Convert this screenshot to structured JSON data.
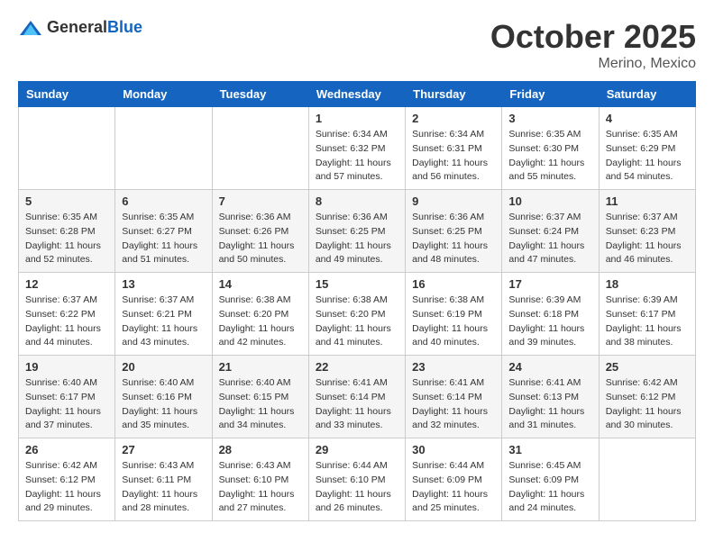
{
  "header": {
    "logo_general": "General",
    "logo_blue": "Blue",
    "month": "October 2025",
    "location": "Merino, Mexico"
  },
  "days_of_week": [
    "Sunday",
    "Monday",
    "Tuesday",
    "Wednesday",
    "Thursday",
    "Friday",
    "Saturday"
  ],
  "weeks": [
    [
      {
        "day": "",
        "info": ""
      },
      {
        "day": "",
        "info": ""
      },
      {
        "day": "",
        "info": ""
      },
      {
        "day": "1",
        "info": "Sunrise: 6:34 AM\nSunset: 6:32 PM\nDaylight: 11 hours\nand 57 minutes."
      },
      {
        "day": "2",
        "info": "Sunrise: 6:34 AM\nSunset: 6:31 PM\nDaylight: 11 hours\nand 56 minutes."
      },
      {
        "day": "3",
        "info": "Sunrise: 6:35 AM\nSunset: 6:30 PM\nDaylight: 11 hours\nand 55 minutes."
      },
      {
        "day": "4",
        "info": "Sunrise: 6:35 AM\nSunset: 6:29 PM\nDaylight: 11 hours\nand 54 minutes."
      }
    ],
    [
      {
        "day": "5",
        "info": "Sunrise: 6:35 AM\nSunset: 6:28 PM\nDaylight: 11 hours\nand 52 minutes."
      },
      {
        "day": "6",
        "info": "Sunrise: 6:35 AM\nSunset: 6:27 PM\nDaylight: 11 hours\nand 51 minutes."
      },
      {
        "day": "7",
        "info": "Sunrise: 6:36 AM\nSunset: 6:26 PM\nDaylight: 11 hours\nand 50 minutes."
      },
      {
        "day": "8",
        "info": "Sunrise: 6:36 AM\nSunset: 6:25 PM\nDaylight: 11 hours\nand 49 minutes."
      },
      {
        "day": "9",
        "info": "Sunrise: 6:36 AM\nSunset: 6:25 PM\nDaylight: 11 hours\nand 48 minutes."
      },
      {
        "day": "10",
        "info": "Sunrise: 6:37 AM\nSunset: 6:24 PM\nDaylight: 11 hours\nand 47 minutes."
      },
      {
        "day": "11",
        "info": "Sunrise: 6:37 AM\nSunset: 6:23 PM\nDaylight: 11 hours\nand 46 minutes."
      }
    ],
    [
      {
        "day": "12",
        "info": "Sunrise: 6:37 AM\nSunset: 6:22 PM\nDaylight: 11 hours\nand 44 minutes."
      },
      {
        "day": "13",
        "info": "Sunrise: 6:37 AM\nSunset: 6:21 PM\nDaylight: 11 hours\nand 43 minutes."
      },
      {
        "day": "14",
        "info": "Sunrise: 6:38 AM\nSunset: 6:20 PM\nDaylight: 11 hours\nand 42 minutes."
      },
      {
        "day": "15",
        "info": "Sunrise: 6:38 AM\nSunset: 6:20 PM\nDaylight: 11 hours\nand 41 minutes."
      },
      {
        "day": "16",
        "info": "Sunrise: 6:38 AM\nSunset: 6:19 PM\nDaylight: 11 hours\nand 40 minutes."
      },
      {
        "day": "17",
        "info": "Sunrise: 6:39 AM\nSunset: 6:18 PM\nDaylight: 11 hours\nand 39 minutes."
      },
      {
        "day": "18",
        "info": "Sunrise: 6:39 AM\nSunset: 6:17 PM\nDaylight: 11 hours\nand 38 minutes."
      }
    ],
    [
      {
        "day": "19",
        "info": "Sunrise: 6:40 AM\nSunset: 6:17 PM\nDaylight: 11 hours\nand 37 minutes."
      },
      {
        "day": "20",
        "info": "Sunrise: 6:40 AM\nSunset: 6:16 PM\nDaylight: 11 hours\nand 35 minutes."
      },
      {
        "day": "21",
        "info": "Sunrise: 6:40 AM\nSunset: 6:15 PM\nDaylight: 11 hours\nand 34 minutes."
      },
      {
        "day": "22",
        "info": "Sunrise: 6:41 AM\nSunset: 6:14 PM\nDaylight: 11 hours\nand 33 minutes."
      },
      {
        "day": "23",
        "info": "Sunrise: 6:41 AM\nSunset: 6:14 PM\nDaylight: 11 hours\nand 32 minutes."
      },
      {
        "day": "24",
        "info": "Sunrise: 6:41 AM\nSunset: 6:13 PM\nDaylight: 11 hours\nand 31 minutes."
      },
      {
        "day": "25",
        "info": "Sunrise: 6:42 AM\nSunset: 6:12 PM\nDaylight: 11 hours\nand 30 minutes."
      }
    ],
    [
      {
        "day": "26",
        "info": "Sunrise: 6:42 AM\nSunset: 6:12 PM\nDaylight: 11 hours\nand 29 minutes."
      },
      {
        "day": "27",
        "info": "Sunrise: 6:43 AM\nSunset: 6:11 PM\nDaylight: 11 hours\nand 28 minutes."
      },
      {
        "day": "28",
        "info": "Sunrise: 6:43 AM\nSunset: 6:10 PM\nDaylight: 11 hours\nand 27 minutes."
      },
      {
        "day": "29",
        "info": "Sunrise: 6:44 AM\nSunset: 6:10 PM\nDaylight: 11 hours\nand 26 minutes."
      },
      {
        "day": "30",
        "info": "Sunrise: 6:44 AM\nSunset: 6:09 PM\nDaylight: 11 hours\nand 25 minutes."
      },
      {
        "day": "31",
        "info": "Sunrise: 6:45 AM\nSunset: 6:09 PM\nDaylight: 11 hours\nand 24 minutes."
      },
      {
        "day": "",
        "info": ""
      }
    ]
  ]
}
